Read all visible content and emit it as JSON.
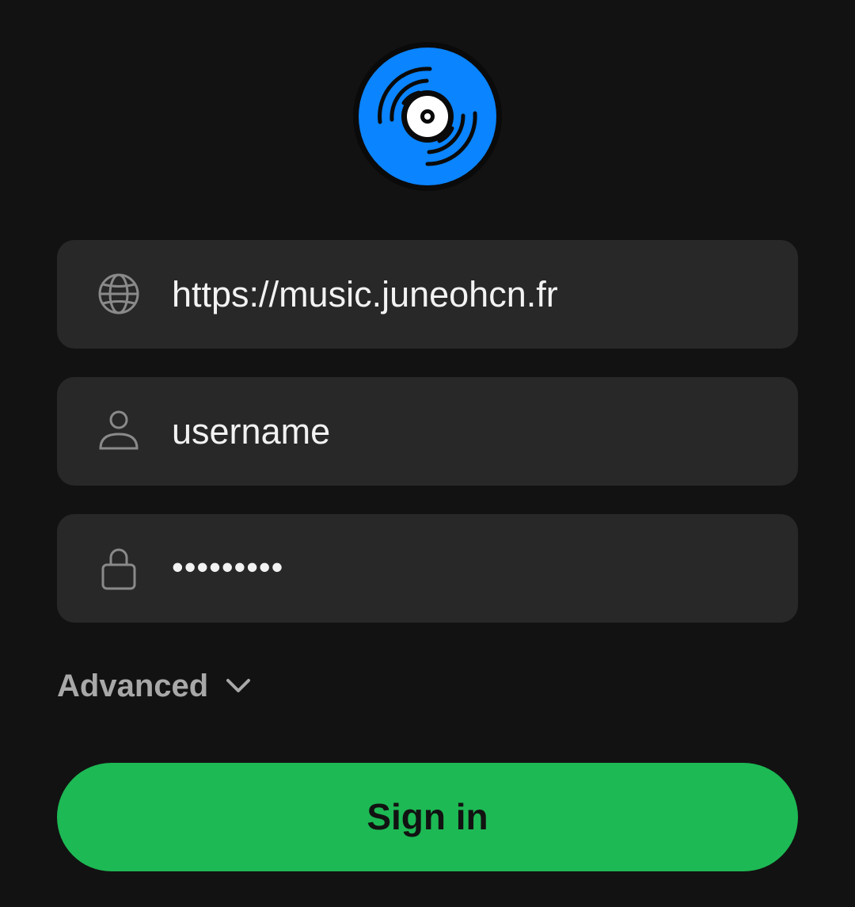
{
  "app": {
    "logo_icon": "vinyl-record-icon",
    "accent_color": "#1db954",
    "logo_color": "#0a84ff"
  },
  "form": {
    "server": {
      "icon": "globe-icon",
      "value": "https://music.juneohcn.fr"
    },
    "username": {
      "icon": "user-icon",
      "value": "username"
    },
    "password": {
      "icon": "lock-icon",
      "value": "•••••••••"
    },
    "advanced": {
      "label": "Advanced",
      "icon": "chevron-down-icon"
    },
    "submit": {
      "label": "Sign in"
    }
  }
}
